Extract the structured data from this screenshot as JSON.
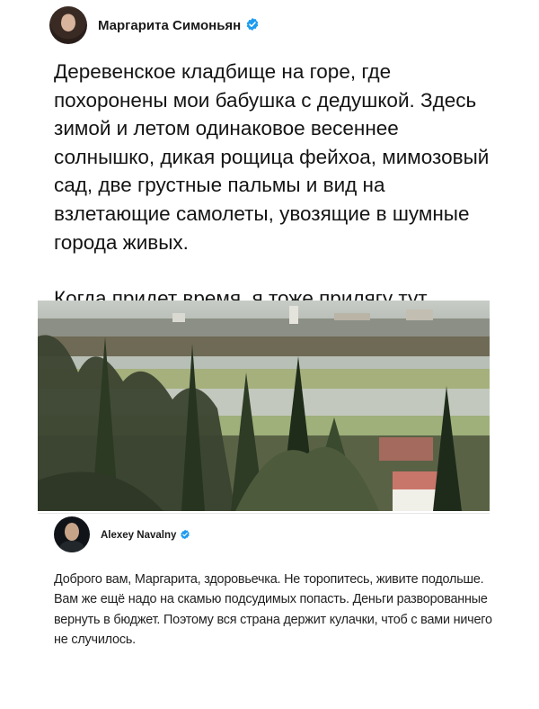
{
  "tweet1": {
    "author": "Маргарита Симоньян",
    "paragraph1": "Деревенское кладбище на горе, где похоронены мои бабушка с дедушкой. Здесь зимой и летом одинаковое весеннее солнышко, дикая рощица фейхоа, мимозовый сад, две грустные пальмы и вид на взлетающие самолеты, увозящие в шумные города живых.",
    "paragraph2": "Когда придет время, я тоже прилягу тут."
  },
  "reply": {
    "author": "Alexey Navalny",
    "text": "Доброго вам, Маргарита, здоровьечка. Не торопитесь, живите подольше. Вам же ещё надо на скамью подсудимых попасть. Деньги разворованные вернуть в бюджет. Поэтому вся страна держит кулачки, чтоб с вами ничего не случилось."
  },
  "colors": {
    "verified": "#1d9bf0",
    "text": "#141414"
  },
  "icons": {
    "verified": "verified-badge-icon"
  }
}
